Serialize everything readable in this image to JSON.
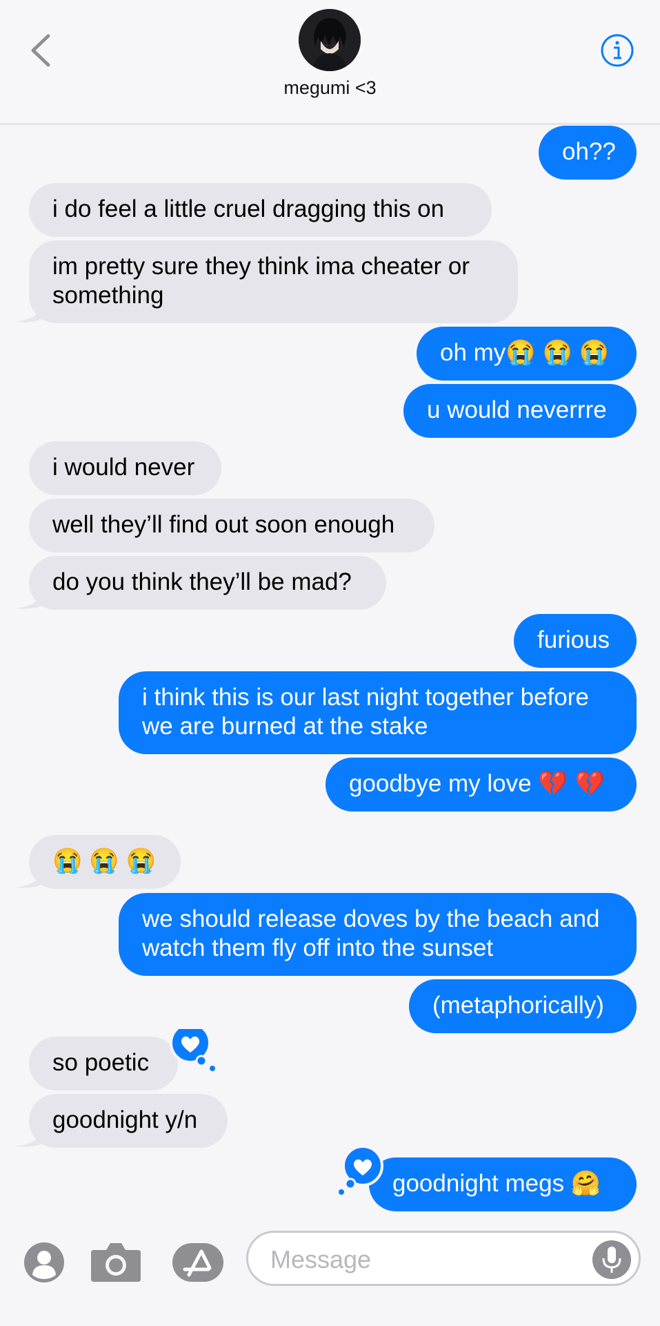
{
  "header": {
    "contact_name": "megumi <3"
  },
  "icons": {
    "back": "chevron-left-icon",
    "info": "info-icon",
    "contacts": "person-icon",
    "camera": "camera-icon",
    "apps": "app-store-icon",
    "mic": "microphone-icon",
    "tapback": "heart-icon"
  },
  "colors": {
    "outgoing_bubble": "#0a7cff",
    "incoming_bubble": "#e6e5eb",
    "accent": "#0a7cff"
  },
  "messages": [
    {
      "direction": "out",
      "text": "oh??"
    },
    {
      "direction": "in",
      "text": "i do feel a little cruel dragging this on"
    },
    {
      "direction": "in",
      "text": "im pretty sure they think ima cheater or something"
    },
    {
      "direction": "out",
      "text": "oh my😭 😭 😭"
    },
    {
      "direction": "out",
      "text": "u would neverrre"
    },
    {
      "direction": "in",
      "text": "i would never"
    },
    {
      "direction": "in",
      "text": "well they’ll find out soon enough"
    },
    {
      "direction": "in",
      "text": "do you think they’ll be mad?"
    },
    {
      "direction": "out",
      "text": "furious"
    },
    {
      "direction": "out",
      "text": "i think this is our last night together before we are burned at the stake"
    },
    {
      "direction": "out",
      "text": "goodbye my love 💔 💔"
    },
    {
      "direction": "in",
      "text": "😭 😭 😭"
    },
    {
      "direction": "out",
      "text": "we should release doves by the beach and watch them fly off into the sunset"
    },
    {
      "direction": "out",
      "text": "(metaphorically)"
    },
    {
      "direction": "in",
      "text": "so poetic",
      "tapback": "heart"
    },
    {
      "direction": "in",
      "text": "goodnight y/n"
    },
    {
      "direction": "out",
      "text": "goodnight megs 🤗",
      "tapback": "heart"
    }
  ],
  "composer": {
    "placeholder": "Message"
  }
}
